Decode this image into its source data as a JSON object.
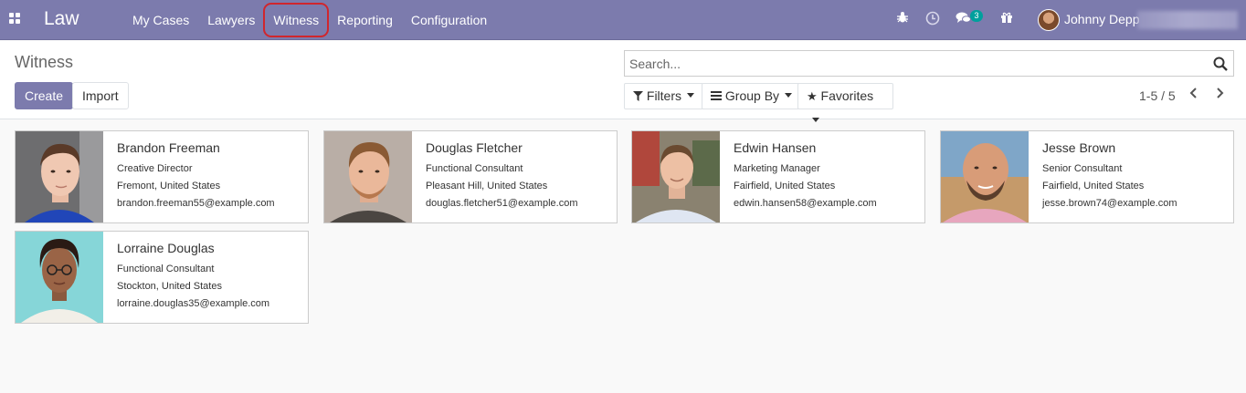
{
  "app": {
    "brand": "Law",
    "menu": [
      {
        "label": "My Cases"
      },
      {
        "label": "Lawyers"
      },
      {
        "label": "Witness"
      },
      {
        "label": "Reporting"
      },
      {
        "label": "Configuration"
      }
    ],
    "systray": {
      "messages_count": "3",
      "user_name": "Johnny Depp"
    }
  },
  "control_panel": {
    "breadcrumb": "Witness",
    "create_label": "Create",
    "import_label": "Import",
    "search_placeholder": "Search...",
    "filters_label": "Filters",
    "group_by_label": "Group By",
    "favorites_label": "Favorites",
    "pager": "1-5 / 5"
  },
  "colors": {
    "navbar": "#7c7bad",
    "highlight": "#d0262d",
    "badge": "#00a09d"
  },
  "witnesses": [
    {
      "name": "Brandon Freeman",
      "job": "Creative Director",
      "location": "Fremont, United States",
      "email": "brandon.freeman55@example.com"
    },
    {
      "name": "Douglas Fletcher",
      "job": "Functional Consultant",
      "location": "Pleasant Hill, United States",
      "email": "douglas.fletcher51@example.com"
    },
    {
      "name": "Edwin Hansen",
      "job": "Marketing Manager",
      "location": "Fairfield, United States",
      "email": "edwin.hansen58@example.com"
    },
    {
      "name": "Jesse Brown",
      "job": "Senior Consultant",
      "location": "Fairfield, United States",
      "email": "jesse.brown74@example.com"
    },
    {
      "name": "Lorraine Douglas",
      "job": "Functional Consultant",
      "location": "Stockton, United States",
      "email": "lorraine.douglas35@example.com"
    }
  ]
}
